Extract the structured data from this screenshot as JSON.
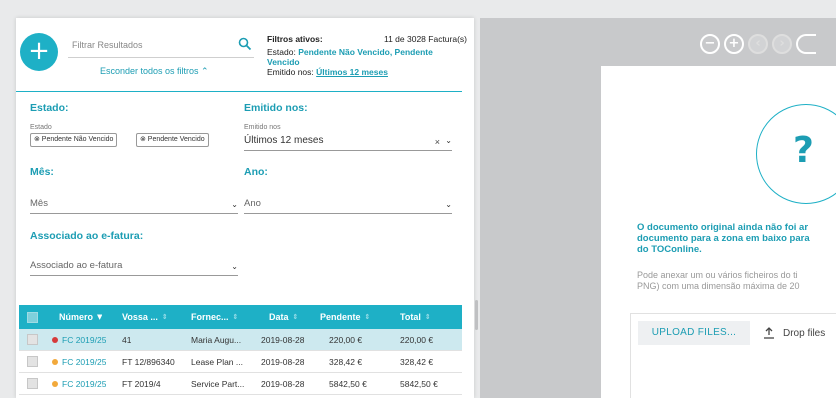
{
  "filters_panel": {
    "add_button": "+",
    "search_placeholder": "Filtrar Resultados",
    "hide_filters_link": "Esconder todos os filtros ⌃",
    "active": {
      "title": "Filtros ativos:",
      "count": "11 de 3028 Factura(s)",
      "estado_label": "Estado:",
      "estado_value_1": "Pendente Não Vencido, Pendente",
      "estado_value_2": "Vencido",
      "emitido_label": "Emitido nos:",
      "emitido_value": "Últimos 12 meses"
    },
    "estado": {
      "title": "Estado:",
      "field_label": "Estado",
      "chips": [
        "⊗ Pendente Não Vencido",
        "⊗ Pendente Vencido"
      ]
    },
    "emitido": {
      "title": "Emitido nos:",
      "field_label": "Emitido nos",
      "value": "Últimos 12 meses",
      "clear": "×"
    },
    "mes": {
      "title": "Mês:",
      "placeholder": "Mês"
    },
    "ano": {
      "title": "Ano:",
      "placeholder": "Ano"
    },
    "efatura": {
      "title": "Associado ao e-fatura:",
      "placeholder": "Associado ao e-fatura"
    }
  },
  "table": {
    "columns": [
      "Número",
      "Vossa ...",
      "Fornec...",
      "Data",
      "Pendente",
      "Total"
    ],
    "rows": [
      {
        "numero": "FC 2019/25",
        "dot": "#d63b3b",
        "vossa": "41",
        "fornecedor": "Maria Augu...",
        "data": "2019-08-28",
        "pendente": "220,00 €",
        "total": "220,00 €",
        "selected": true
      },
      {
        "numero": "FC 2019/25",
        "dot": "#f2a93b",
        "vossa": "FT 12/896340",
        "fornecedor": "Lease Plan ...",
        "data": "2019-08-28",
        "pendente": "328,42 €",
        "total": "328,42 €",
        "selected": false
      },
      {
        "numero": "FC 2019/25",
        "dot": "#f2a93b",
        "vossa": "FT 2019/4",
        "fornecedor": "Service Part...",
        "data": "2019-08-28",
        "pendente": "5842,50 €",
        "total": "5842,50 €",
        "selected": false
      }
    ]
  },
  "preview": {
    "toolbar": [
      "−",
      "+",
      "‹",
      "›",
      ""
    ],
    "question_mark": "?",
    "message_lines": [
      "O documento original ainda não foi ar",
      "documento para a zona em baixo para",
      "do TOConline."
    ],
    "help_lines": [
      "Pode anexar um ou vários ficheiros do ti",
      "PNG) com uma dimensão máxima de 20"
    ],
    "upload_button": "UPLOAD FILES...",
    "drop_label": "Drop files"
  },
  "colors": {
    "accent": "#1eb0c6",
    "link": "#1c9db3",
    "selected_row": "#cde9ef"
  }
}
